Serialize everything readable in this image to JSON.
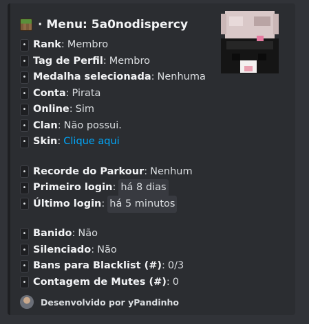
{
  "embed": {
    "author": {
      "name": "5a0nodispercy",
      "prefix": "Menu: ",
      "bullet": "·",
      "icon": "minecraft-grass-block-icon"
    },
    "thumbnail": "minecraft-skin-avatar",
    "groups": [
      [
        {
          "key": "Rank",
          "value": "Membro",
          "style": "text"
        },
        {
          "key": "Tag de Perfil",
          "value": "Membro",
          "style": "text"
        },
        {
          "key": "Medalha selecionada",
          "value": "Nenhuma",
          "style": "text"
        },
        {
          "key": "Conta",
          "value": "Pirata",
          "style": "text"
        },
        {
          "key": "Online",
          "value": "Sim",
          "style": "text"
        },
        {
          "key": "Clan",
          "value": "Não possui.",
          "style": "text"
        },
        {
          "key": "Skin",
          "value": "Clique aqui",
          "style": "link"
        }
      ],
      [
        {
          "key": "Recorde do Parkour",
          "value": "Nenhum",
          "style": "text"
        },
        {
          "key": "Primeiro login",
          "value": "há 8 dias",
          "style": "code"
        },
        {
          "key": "Último login",
          "value": "há 5 minutos",
          "style": "code"
        }
      ],
      [
        {
          "key": "Banido",
          "value": "Não",
          "style": "text"
        },
        {
          "key": "Silenciado",
          "value": "Não",
          "style": "text"
        },
        {
          "key": "Bans para Blacklist (#)",
          "value": "0/3",
          "style": "text"
        },
        {
          "key": "Contagem de Mutes (#)",
          "value": "0",
          "style": "text"
        }
      ]
    ],
    "bullet_glyph": "•",
    "separator": ":",
    "footer": {
      "text": "Desenvolvido por yPandinho",
      "icon": "developer-avatar"
    },
    "colors": {
      "background": "#313338",
      "embed": "#2b2d31",
      "link": "#00a8fc"
    }
  }
}
